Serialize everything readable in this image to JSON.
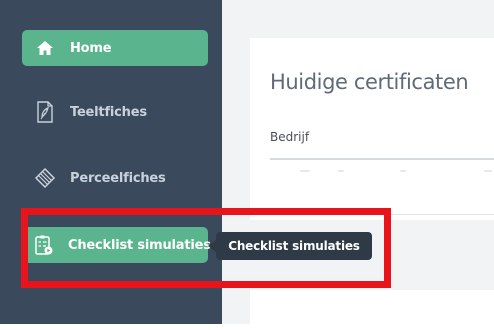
{
  "sidebar": {
    "items": [
      {
        "label": "Home",
        "icon": "home-icon",
        "active": true
      },
      {
        "label": "Teeltfiches",
        "icon": "document-icon",
        "active": false
      },
      {
        "label": "Perceelfiches",
        "icon": "parcel-icon",
        "active": false
      },
      {
        "label": "Checklist simulaties",
        "icon": "checklist-icon",
        "active": true
      }
    ]
  },
  "tooltip": {
    "text": "Checklist simulaties"
  },
  "main": {
    "card_title": "Huidige certificaten",
    "column_header": "Bedrijf"
  },
  "colors": {
    "sidebar_bg": "#3a4a5c",
    "accent": "#5ab48e",
    "tooltip_bg": "#2e3a46",
    "highlight": "#e8141b"
  }
}
